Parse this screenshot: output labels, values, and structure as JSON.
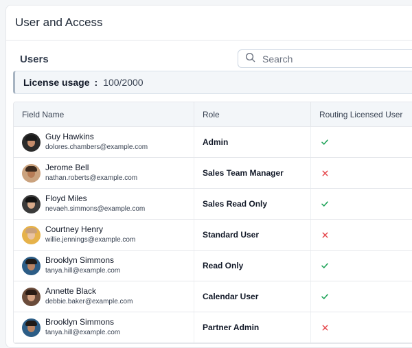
{
  "page": {
    "title": "User and Access"
  },
  "users_section": {
    "title": "Users"
  },
  "search": {
    "placeholder": "Search",
    "icon": "search-icon"
  },
  "license": {
    "label": "License usage",
    "separator": ":",
    "value": "100/2000"
  },
  "table": {
    "columns": [
      "Field Name",
      "Role",
      "Routing Licensed User"
    ],
    "rows": [
      {
        "name": "Guy Hawkins",
        "email": "dolores.chambers@example.com",
        "role": "Admin",
        "routing_licensed": true,
        "avatar": {
          "bg": "#2b2b2b",
          "face": "#c58c6b",
          "hair": "#1a1a1a"
        }
      },
      {
        "name": "Jerome Bell",
        "email": "nathan.roberts@example.com",
        "role": "Sales Team Manager",
        "routing_licensed": false,
        "avatar": {
          "bg": "#caa27e",
          "face": "#b77c56",
          "hair": "#3b2a1e"
        }
      },
      {
        "name": "Floyd Miles",
        "email": "nevaeh.simmons@example.com",
        "role": "Sales Read Only",
        "routing_licensed": true,
        "avatar": {
          "bg": "#3a3a3a",
          "face": "#d6a98a",
          "hair": "#121212"
        }
      },
      {
        "name": "Courtney Henry",
        "email": "willie.jennings@example.com",
        "role": "Standard User",
        "routing_licensed": false,
        "avatar": {
          "bg": "#e6b24a",
          "face": "#e9c3a3",
          "hair": "#c9a07a"
        }
      },
      {
        "name": "Brooklyn Simmons",
        "email": "tanya.hill@example.com",
        "role": "Read Only",
        "routing_licensed": true,
        "avatar": {
          "bg": "#2c5d86",
          "face": "#b98464",
          "hair": "#1f1a17"
        }
      },
      {
        "name": "Annette Black",
        "email": "debbie.baker@example.com",
        "role": "Calendar User",
        "routing_licensed": true,
        "avatar": {
          "bg": "#6b4c3b",
          "face": "#d3a081",
          "hair": "#2a1b14"
        }
      },
      {
        "name": "Brooklyn Simmons",
        "email": "tanya.hill@example.com",
        "role": "Partner Admin",
        "routing_licensed": false,
        "avatar": {
          "bg": "#2c5d86",
          "face": "#b98464",
          "hair": "#1f1a17"
        }
      }
    ]
  },
  "colors": {
    "check": "#22a55b",
    "cross": "#e5484d",
    "border": "#e5e7eb"
  }
}
